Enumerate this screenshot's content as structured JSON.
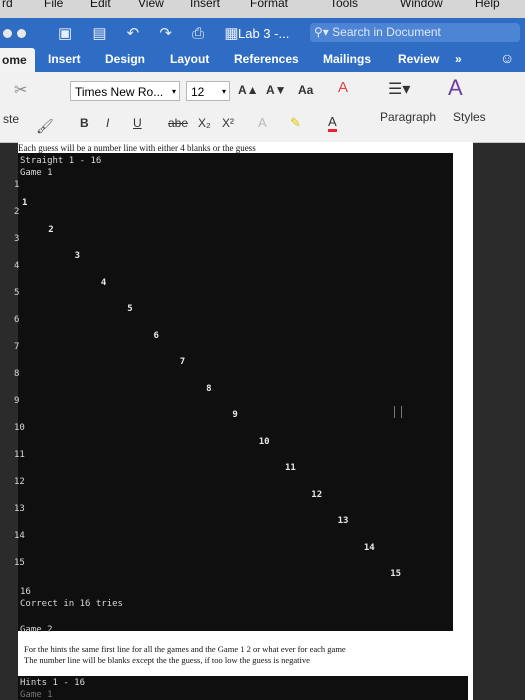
{
  "menubar": {
    "items": [
      "rd",
      "File",
      "Edit",
      "View",
      "Insert",
      "Format",
      "Tools",
      "Window",
      "Help"
    ]
  },
  "titlebar": {
    "doc_title": "Lab 3 -...",
    "search_placeholder": "Search in Document",
    "smiley": "☺"
  },
  "tabs": [
    "ome",
    "Insert",
    "Design",
    "Layout",
    "References",
    "Mailings",
    "Review",
    "»"
  ],
  "ribbon": {
    "font_name": "Times New Ro...",
    "font_size": "12",
    "bold": "B",
    "italic": "I",
    "underline": "U",
    "strike": "abe",
    "sub": "X₂",
    "sup": "X²",
    "paste": "ste",
    "grow": "A▲",
    "shrink": "A▼",
    "case": "Aa",
    "paragraph": "Paragraph",
    "styles": "Styles"
  },
  "document": {
    "intro": "Each guess will be a number line with either 4 blanks or the guess",
    "console1_top": "Straight 1 - 16",
    "game1_label": "Game 1",
    "row_numbers": [
      "1",
      "2",
      "3",
      "4",
      "5",
      "6",
      "7",
      "8",
      "9",
      "10",
      "11",
      "12",
      "13",
      "14",
      "15"
    ],
    "diag_numbers": [
      "1",
      "2",
      "3",
      "4",
      "5",
      "6",
      "7",
      "8",
      "9",
      "10",
      "11",
      "12",
      "13",
      "14",
      "15"
    ],
    "last_row": "16",
    "result": "Correct in 16 tries",
    "game2_label": "Game 2",
    "note1": "For the hints the same first line for all the games and the Game 1 2 or what ever for each game",
    "note2": "The number line will be blanks except the the guess, if too low the guess is negative",
    "console2_line1": "Hints 1 - 16",
    "console2_line2": "Game 1"
  },
  "colors": {
    "title_blue": "#2f6cc4",
    "console_bg": "#0f0f10"
  }
}
